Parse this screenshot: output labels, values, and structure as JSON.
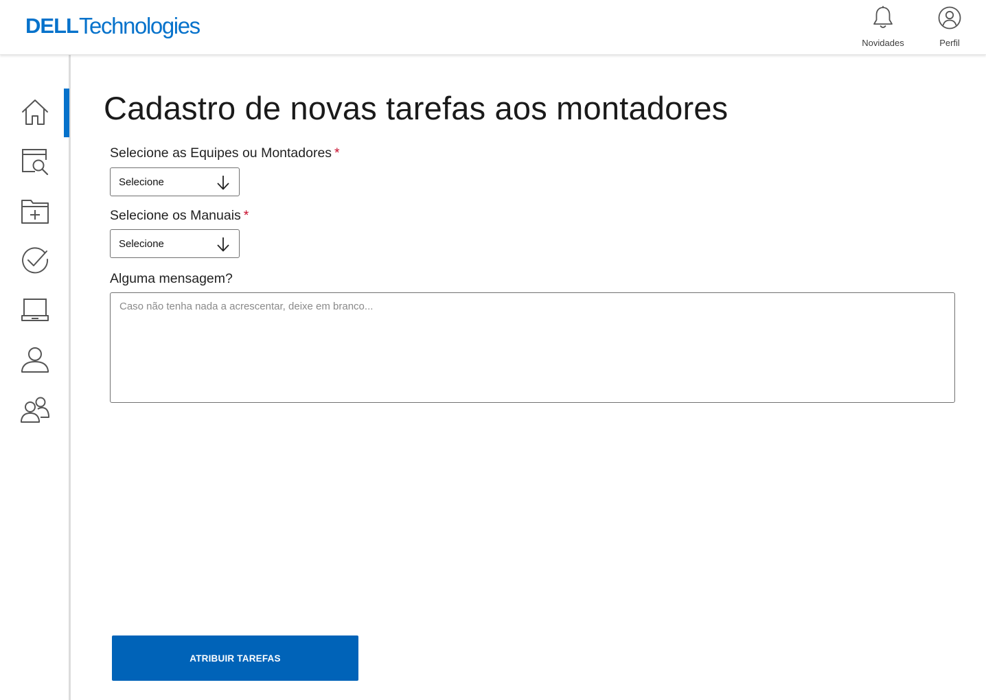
{
  "header": {
    "logo": {
      "brand": "DELL",
      "suffix": "Technologies"
    },
    "actions": [
      {
        "label": "Novidades",
        "icon": "bell-icon"
      },
      {
        "label": "Perfil",
        "icon": "user-circle-icon"
      }
    ]
  },
  "sidebar": {
    "items": [
      {
        "icon": "home-icon",
        "active": true
      },
      {
        "icon": "search-document-icon",
        "active": false
      },
      {
        "icon": "folder-add-icon",
        "active": false
      },
      {
        "icon": "check-circle-icon",
        "active": false
      },
      {
        "icon": "laptop-icon",
        "active": false
      },
      {
        "icon": "user-icon",
        "active": false
      },
      {
        "icon": "users-icon",
        "active": false
      }
    ],
    "accent_color": "#0672cb"
  },
  "main": {
    "title": "Cadastro de novas tarefas aos montadores",
    "teams_field": {
      "label": "Selecione as Equipes ou Montadores",
      "required_mark": "*",
      "value": "Selecione"
    },
    "manuals_field": {
      "label": "Selecione os Manuais",
      "required_mark": "*",
      "value": "Selecione"
    },
    "message_field": {
      "label": "Alguma mensagem?",
      "placeholder": "Caso não tenha nada a acrescentar, deixe em branco...",
      "value": ""
    },
    "submit_label": "ATRIBUIR TAREFAS"
  },
  "colors": {
    "brand": "#0672cb",
    "button": "#0063b8",
    "required": "#c8102e"
  }
}
